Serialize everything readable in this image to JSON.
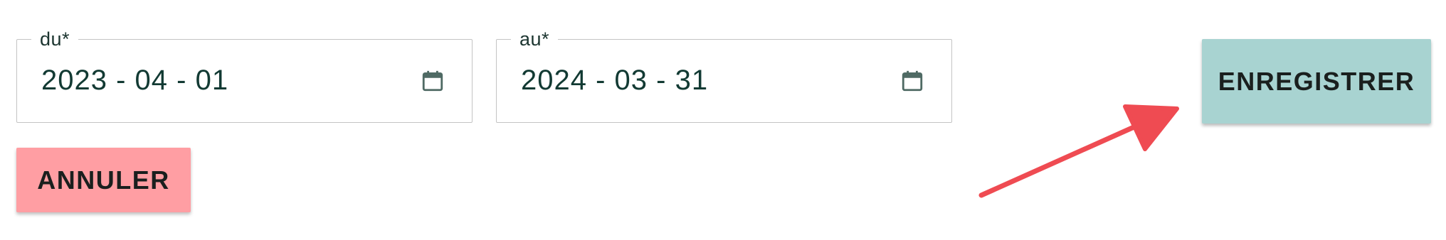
{
  "form": {
    "start_date": {
      "label": "du*",
      "value": "2023 - 04 - 01",
      "icon": "calendar-icon"
    },
    "end_date": {
      "label": "au*",
      "value": "2024 - 03 - 31",
      "icon": "calendar-icon"
    }
  },
  "actions": {
    "save_label": "ENREGISTRER",
    "cancel_label": "ANNULER"
  },
  "annotation": {
    "type": "arrow",
    "points_to": "save-button",
    "color": "#ef4b52"
  },
  "colors": {
    "save_button": "#a8d3d1",
    "cancel_button": "#ff9ea3",
    "field_border": "#c4c4c4",
    "icon": "#4f6a64",
    "text": "#123a33"
  }
}
